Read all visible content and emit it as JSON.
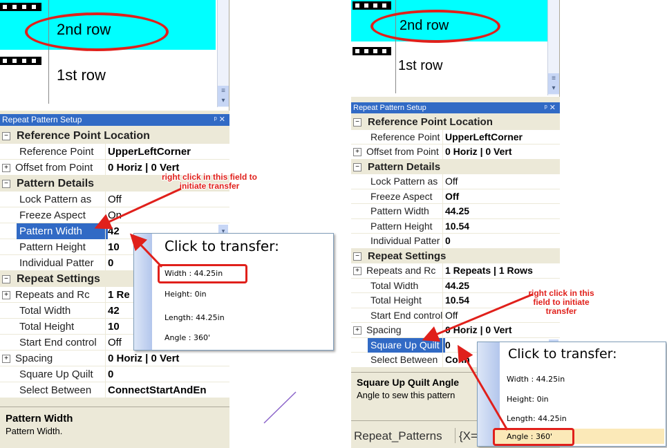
{
  "left": {
    "rows": {
      "second": "2nd row",
      "first": "1st row"
    },
    "panel_title": "Repeat Pattern Setup",
    "properties": [
      {
        "type": "category",
        "name": "Reference Point Location"
      },
      {
        "type": "prop",
        "name": "Reference Point",
        "value": "UpperLeftCorner"
      },
      {
        "type": "prop",
        "name": "Offset from Point",
        "value": "0 Horiz | 0 Vert",
        "expand": "+"
      },
      {
        "type": "category",
        "name": "Pattern Details"
      },
      {
        "type": "prop",
        "name": "Lock Pattern as",
        "value": "Off",
        "plain": true
      },
      {
        "type": "prop",
        "name": "Freeze Aspect",
        "value": "On",
        "plain": true
      },
      {
        "type": "prop",
        "name": "Pattern Width",
        "value": "42",
        "selected": true
      },
      {
        "type": "prop",
        "name": "Pattern Height",
        "value": "10"
      },
      {
        "type": "prop",
        "name": "Individual Patter",
        "value": "0"
      },
      {
        "type": "category",
        "name": "Repeat Settings"
      },
      {
        "type": "prop",
        "name": "Repeats and Rc",
        "value": "1 Re",
        "expand": "+"
      },
      {
        "type": "prop",
        "name": "Total Width",
        "value": "42"
      },
      {
        "type": "prop",
        "name": "Total Height",
        "value": "10"
      },
      {
        "type": "prop",
        "name": "Start End control",
        "value": "Off",
        "plain": true
      },
      {
        "type": "prop",
        "name": "Spacing",
        "value": "0 Horiz | 0 Vert",
        "expand": "+"
      },
      {
        "type": "prop",
        "name": "Square Up Quilt",
        "value": "0"
      },
      {
        "type": "prop",
        "name": "Select Between",
        "value": "ConnectStartAndEn"
      }
    ],
    "description": {
      "title": "Pattern Width",
      "text": "Pattern Width."
    },
    "popup": {
      "header": "Click to transfer:",
      "items": [
        "Width : 44.25in",
        "Height: 0in",
        "Length: 44.25in",
        "Angle : 360'"
      ]
    },
    "annotation": "right click in this field to initiate transfer"
  },
  "right": {
    "rows": {
      "second": "2nd row",
      "first": "1st row"
    },
    "panel_title": "Repeat Pattern Setup",
    "properties": [
      {
        "type": "category",
        "name": "Reference Point Location"
      },
      {
        "type": "prop",
        "name": "Reference Point",
        "value": "UpperLeftCorner"
      },
      {
        "type": "prop",
        "name": "Offset from Point",
        "value": "0 Horiz | 0 Vert",
        "expand": "+"
      },
      {
        "type": "category",
        "name": "Pattern Details"
      },
      {
        "type": "prop",
        "name": "Lock Pattern as",
        "value": "Off",
        "plain": true
      },
      {
        "type": "prop",
        "name": "Freeze Aspect",
        "value": "Off"
      },
      {
        "type": "prop",
        "name": "Pattern Width",
        "value": "44.25"
      },
      {
        "type": "prop",
        "name": "Pattern Height",
        "value": "10.54"
      },
      {
        "type": "prop",
        "name": "Individual Patter",
        "value": "0"
      },
      {
        "type": "category",
        "name": "Repeat Settings"
      },
      {
        "type": "prop",
        "name": "Repeats and Rc",
        "value": "1 Repeats | 1 Rows",
        "expand": "+"
      },
      {
        "type": "prop",
        "name": "Total Width",
        "value": "44.25"
      },
      {
        "type": "prop",
        "name": "Total Height",
        "value": "10.54"
      },
      {
        "type": "prop",
        "name": "Start End control",
        "value": "Off",
        "plain": true
      },
      {
        "type": "prop",
        "name": "Spacing",
        "value": "0 Horiz | 0 Vert",
        "expand": "+"
      },
      {
        "type": "prop",
        "name": "Square Up Quilt",
        "value": "0",
        "selected": true
      },
      {
        "type": "prop",
        "name": "Select Between",
        "value": "Conn"
      }
    ],
    "description": {
      "title": "Square Up Quilt Angle",
      "text": "Angle to sew this pattern"
    },
    "status": {
      "name": "Repeat_Patterns",
      "coords": "{X="
    },
    "popup": {
      "header": "Click to transfer:",
      "items": [
        "Width : 44.25in",
        "Height: 0in",
        "Length: 44.25in",
        "Angle : 360'"
      ]
    },
    "annotation": "right click in this field to initiate transfer"
  },
  "colors": {
    "accent": "#316ac5",
    "highlight_row": "#00ffff",
    "annotation": "#e0201b",
    "panel_bg": "#ece9d8"
  }
}
